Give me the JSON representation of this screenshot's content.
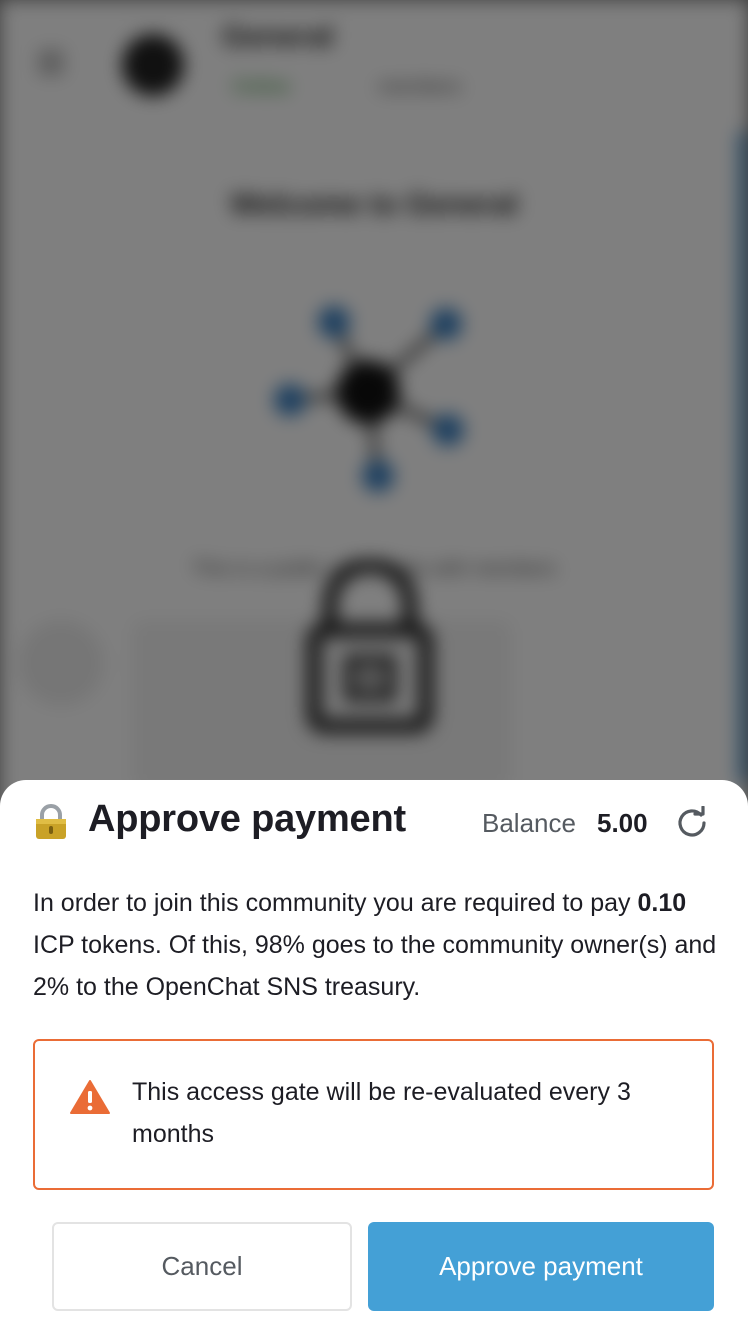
{
  "background": {
    "header_title": "General",
    "header_status": "Online",
    "header_members": "members",
    "welcome": "Welcome to General",
    "description": "This is a public community with members"
  },
  "modal": {
    "title": "Approve payment",
    "balance_label": "Balance",
    "balance_value": "5.00",
    "description_amount": "0.10",
    "description_line1": "In order to join this community you are required to pay",
    "description_rest": " ICP tokens. Of this, 98% goes to the community owner(s) and 2% to the OpenChat SNS treasury.",
    "warning_text": "This access gate will be re-evaluated every 3 months",
    "cancel_label": "Cancel",
    "approve_label": "Approve payment"
  },
  "colors": {
    "accent": "#44a0d6",
    "warning": "#ea6c36"
  },
  "icons": {
    "lock": "lock-icon",
    "refresh": "refresh-icon",
    "warning": "warning-triangle-icon"
  }
}
